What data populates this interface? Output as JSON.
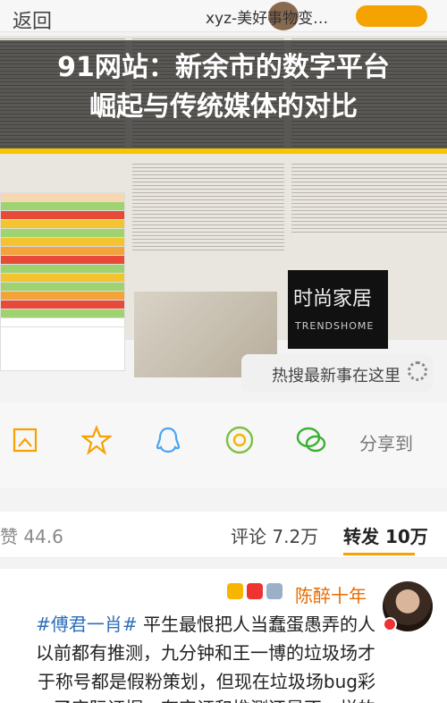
{
  "header": {
    "back_label": "返回",
    "title": "xyz-美好事物变…"
  },
  "banner": {
    "title_line1": "91网站：新余市的数字平台",
    "title_line2": "崛起与传统媒体的对比"
  },
  "article_image": {
    "photo2_caption": "时尚家居",
    "photo2_sub": "TRENDSHOME"
  },
  "hot_search": {
    "label": "热搜最新事在这里"
  },
  "share": {
    "label": "分享到",
    "icons": [
      "wechat-icon",
      "moments-icon",
      "qq-icon",
      "favorite-icon",
      "save-image-icon"
    ]
  },
  "tabs": [
    {
      "label": "转发 10万"
    },
    {
      "label": "评论 7.2万"
    },
    {
      "label": "赞 44.6"
    }
  ],
  "comment": {
    "name": "陈醉十年",
    "line1_hash": "#傅君一肖#",
    "line1": "平生最恨把人当蠢蛋愚弄的人",
    "line2": "以前都有推测，九分钟和王一博的垃圾场才",
    "line3": "于称号都是假粉策划，但现在垃圾场bug彩",
    "line4": "了实际证据，有实证和推测还是不一样的"
  },
  "colors": {
    "accent": "#f7a100",
    "banner_bg": "#000000",
    "banner_line": "#f7c600",
    "link": "#2e6fb6",
    "name": "#e86a00"
  }
}
